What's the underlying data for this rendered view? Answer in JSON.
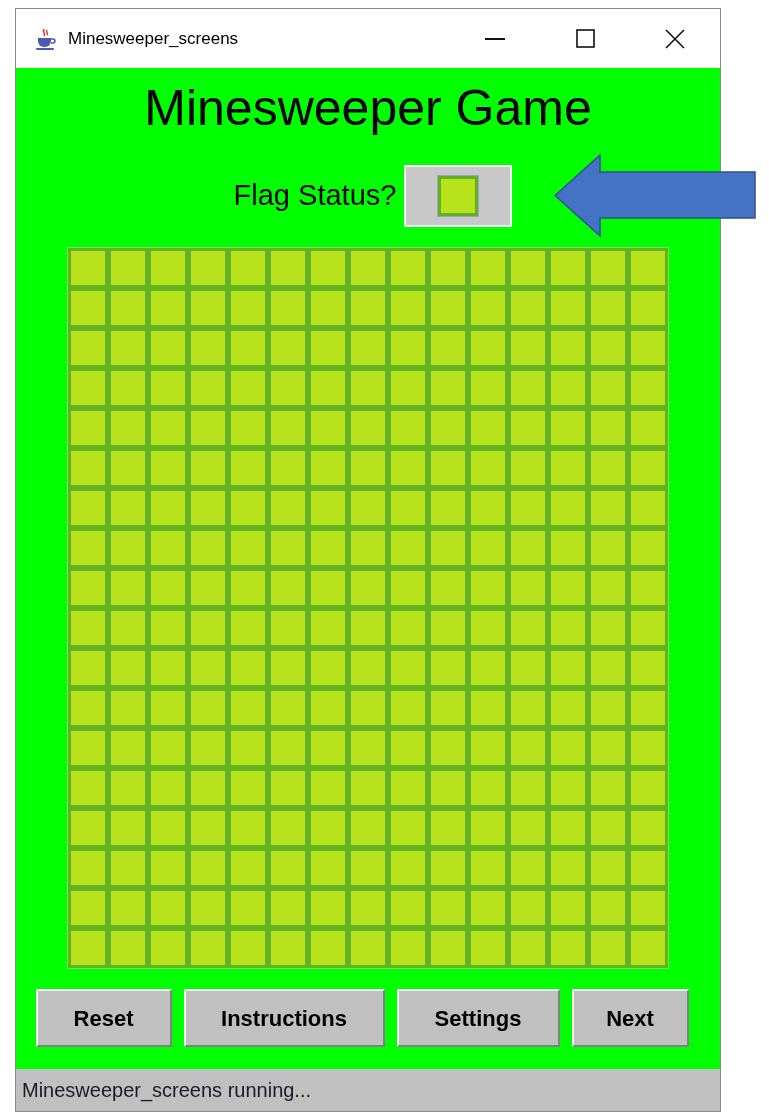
{
  "window": {
    "title": "Minesweeper_screens"
  },
  "heading": "Minesweeper Game",
  "flag_status": {
    "label": "Flag Status?",
    "on": false
  },
  "grid": {
    "rows": [
      {
        "cells": [
          {
            "revealed": false
          },
          {
            "revealed": false
          },
          {
            "revealed": false
          },
          {
            "revealed": false
          },
          {
            "revealed": false
          },
          {
            "revealed": false
          },
          {
            "revealed": false
          },
          {
            "revealed": false
          },
          {
            "revealed": false
          },
          {
            "revealed": false
          },
          {
            "revealed": false
          },
          {
            "revealed": false
          },
          {
            "revealed": false
          },
          {
            "revealed": false
          },
          {
            "revealed": false
          }
        ]
      },
      {
        "cells": [
          {
            "revealed": false
          },
          {
            "revealed": false
          },
          {
            "revealed": false
          },
          {
            "revealed": false
          },
          {
            "revealed": false
          },
          {
            "revealed": false
          },
          {
            "revealed": false
          },
          {
            "revealed": false
          },
          {
            "revealed": false
          },
          {
            "revealed": false
          },
          {
            "revealed": false
          },
          {
            "revealed": false
          },
          {
            "revealed": false
          },
          {
            "revealed": false
          },
          {
            "revealed": false
          }
        ]
      },
      {
        "cells": [
          {
            "revealed": false
          },
          {
            "revealed": false
          },
          {
            "revealed": false
          },
          {
            "revealed": false
          },
          {
            "revealed": false
          },
          {
            "revealed": false
          },
          {
            "revealed": false
          },
          {
            "revealed": false
          },
          {
            "revealed": false
          },
          {
            "revealed": false
          },
          {
            "revealed": false
          },
          {
            "revealed": false
          },
          {
            "revealed": false
          },
          {
            "revealed": false
          },
          {
            "revealed": false
          }
        ]
      },
      {
        "cells": [
          {
            "revealed": false
          },
          {
            "revealed": false
          },
          {
            "revealed": false
          },
          {
            "revealed": false
          },
          {
            "revealed": false
          },
          {
            "revealed": false
          },
          {
            "revealed": false
          },
          {
            "revealed": false
          },
          {
            "revealed": false
          },
          {
            "revealed": false
          },
          {
            "revealed": false
          },
          {
            "revealed": false
          },
          {
            "revealed": false
          },
          {
            "revealed": false
          },
          {
            "revealed": false
          }
        ]
      },
      {
        "cells": [
          {
            "revealed": false
          },
          {
            "revealed": false
          },
          {
            "revealed": false
          },
          {
            "revealed": false
          },
          {
            "revealed": false
          },
          {
            "revealed": false
          },
          {
            "revealed": false
          },
          {
            "revealed": false
          },
          {
            "revealed": false
          },
          {
            "revealed": false
          },
          {
            "revealed": false
          },
          {
            "revealed": false
          },
          {
            "revealed": false
          },
          {
            "revealed": false
          },
          {
            "revealed": false
          }
        ]
      },
      {
        "cells": [
          {
            "revealed": false
          },
          {
            "revealed": false
          },
          {
            "revealed": false
          },
          {
            "revealed": false
          },
          {
            "revealed": false
          },
          {
            "revealed": false
          },
          {
            "revealed": false
          },
          {
            "revealed": false
          },
          {
            "revealed": false
          },
          {
            "revealed": false
          },
          {
            "revealed": false
          },
          {
            "revealed": false
          },
          {
            "revealed": false
          },
          {
            "revealed": false
          },
          {
            "revealed": false
          }
        ]
      },
      {
        "cells": [
          {
            "revealed": false
          },
          {
            "revealed": false
          },
          {
            "revealed": false
          },
          {
            "revealed": false
          },
          {
            "revealed": false
          },
          {
            "revealed": false
          },
          {
            "revealed": false
          },
          {
            "revealed": false
          },
          {
            "revealed": false
          },
          {
            "revealed": false
          },
          {
            "revealed": false
          },
          {
            "revealed": false
          },
          {
            "revealed": false
          },
          {
            "revealed": false
          },
          {
            "revealed": false
          }
        ]
      },
      {
        "cells": [
          {
            "revealed": false
          },
          {
            "revealed": false
          },
          {
            "revealed": false
          },
          {
            "revealed": false
          },
          {
            "revealed": false
          },
          {
            "revealed": false
          },
          {
            "revealed": false
          },
          {
            "revealed": false
          },
          {
            "revealed": false
          },
          {
            "revealed": false
          },
          {
            "revealed": false
          },
          {
            "revealed": false
          },
          {
            "revealed": false
          },
          {
            "revealed": false
          },
          {
            "revealed": false
          }
        ]
      },
      {
        "cells": [
          {
            "revealed": false
          },
          {
            "revealed": false
          },
          {
            "revealed": false
          },
          {
            "revealed": false
          },
          {
            "revealed": false
          },
          {
            "revealed": false
          },
          {
            "revealed": false
          },
          {
            "revealed": false
          },
          {
            "revealed": false
          },
          {
            "revealed": false
          },
          {
            "revealed": false
          },
          {
            "revealed": false
          },
          {
            "revealed": false
          },
          {
            "revealed": false
          },
          {
            "revealed": false
          }
        ]
      },
      {
        "cells": [
          {
            "revealed": false
          },
          {
            "revealed": false
          },
          {
            "revealed": false
          },
          {
            "revealed": false
          },
          {
            "revealed": false
          },
          {
            "revealed": false
          },
          {
            "revealed": false
          },
          {
            "revealed": false
          },
          {
            "revealed": false
          },
          {
            "revealed": false
          },
          {
            "revealed": false
          },
          {
            "revealed": false
          },
          {
            "revealed": false
          },
          {
            "revealed": false
          },
          {
            "revealed": false
          }
        ]
      },
      {
        "cells": [
          {
            "revealed": false
          },
          {
            "revealed": false
          },
          {
            "revealed": false
          },
          {
            "revealed": false
          },
          {
            "revealed": false
          },
          {
            "revealed": false
          },
          {
            "revealed": false
          },
          {
            "revealed": false
          },
          {
            "revealed": false
          },
          {
            "revealed": false
          },
          {
            "revealed": false
          },
          {
            "revealed": false
          },
          {
            "revealed": false
          },
          {
            "revealed": false
          },
          {
            "revealed": false
          }
        ]
      },
      {
        "cells": [
          {
            "revealed": false
          },
          {
            "revealed": false
          },
          {
            "revealed": false
          },
          {
            "revealed": false
          },
          {
            "revealed": false
          },
          {
            "revealed": false
          },
          {
            "revealed": false
          },
          {
            "revealed": false
          },
          {
            "revealed": false
          },
          {
            "revealed": false
          },
          {
            "revealed": false
          },
          {
            "revealed": false
          },
          {
            "revealed": false
          },
          {
            "revealed": false
          },
          {
            "revealed": false
          }
        ]
      },
      {
        "cells": [
          {
            "revealed": false
          },
          {
            "revealed": false
          },
          {
            "revealed": false
          },
          {
            "revealed": false
          },
          {
            "revealed": false
          },
          {
            "revealed": false
          },
          {
            "revealed": false
          },
          {
            "revealed": false
          },
          {
            "revealed": false
          },
          {
            "revealed": false
          },
          {
            "revealed": false
          },
          {
            "revealed": false
          },
          {
            "revealed": false
          },
          {
            "revealed": false
          },
          {
            "revealed": false
          }
        ]
      },
      {
        "cells": [
          {
            "revealed": false
          },
          {
            "revealed": false
          },
          {
            "revealed": false
          },
          {
            "revealed": false
          },
          {
            "revealed": false
          },
          {
            "revealed": false
          },
          {
            "revealed": false
          },
          {
            "revealed": false
          },
          {
            "revealed": false
          },
          {
            "revealed": false
          },
          {
            "revealed": false
          },
          {
            "revealed": false
          },
          {
            "revealed": false
          },
          {
            "revealed": false
          },
          {
            "revealed": false
          }
        ]
      },
      {
        "cells": [
          {
            "revealed": false
          },
          {
            "revealed": false
          },
          {
            "revealed": false
          },
          {
            "revealed": false
          },
          {
            "revealed": false
          },
          {
            "revealed": false
          },
          {
            "revealed": false
          },
          {
            "revealed": false
          },
          {
            "revealed": false
          },
          {
            "revealed": false
          },
          {
            "revealed": false
          },
          {
            "revealed": false
          },
          {
            "revealed": false
          },
          {
            "revealed": false
          },
          {
            "revealed": false
          }
        ]
      },
      {
        "cells": [
          {
            "revealed": false
          },
          {
            "revealed": false
          },
          {
            "revealed": false
          },
          {
            "revealed": false
          },
          {
            "revealed": false
          },
          {
            "revealed": false
          },
          {
            "revealed": false
          },
          {
            "revealed": false
          },
          {
            "revealed": false
          },
          {
            "revealed": false
          },
          {
            "revealed": false
          },
          {
            "revealed": false
          },
          {
            "revealed": false
          },
          {
            "revealed": false
          },
          {
            "revealed": false
          }
        ]
      },
      {
        "cells": [
          {
            "revealed": false
          },
          {
            "revealed": false
          },
          {
            "revealed": false
          },
          {
            "revealed": false
          },
          {
            "revealed": false
          },
          {
            "revealed": false
          },
          {
            "revealed": false
          },
          {
            "revealed": false
          },
          {
            "revealed": false
          },
          {
            "revealed": false
          },
          {
            "revealed": false
          },
          {
            "revealed": false
          },
          {
            "revealed": false
          },
          {
            "revealed": false
          },
          {
            "revealed": false
          }
        ]
      },
      {
        "cells": [
          {
            "revealed": false
          },
          {
            "revealed": false
          },
          {
            "revealed": false
          },
          {
            "revealed": false
          },
          {
            "revealed": false
          },
          {
            "revealed": false
          },
          {
            "revealed": false
          },
          {
            "revealed": false
          },
          {
            "revealed": false
          },
          {
            "revealed": false
          },
          {
            "revealed": false
          },
          {
            "revealed": false
          },
          {
            "revealed": false
          },
          {
            "revealed": false
          },
          {
            "revealed": false
          }
        ]
      }
    ]
  },
  "buttons": [
    "Reset",
    "Instructions",
    "Settings",
    "Next"
  ],
  "status_bar": "Minesweeper_screens running..."
}
